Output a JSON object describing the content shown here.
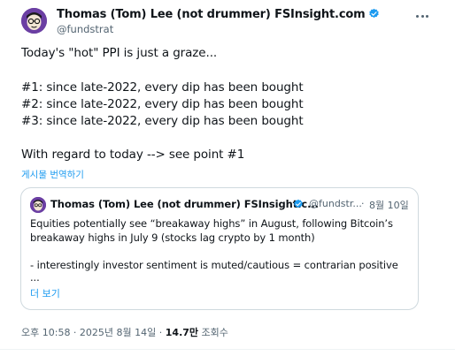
{
  "author": {
    "display_name": "Thomas (Tom) Lee (not drummer) FSInsight.com",
    "handle": "@fundstrat",
    "verified_color": "#1d9bf0",
    "avatar_icon": "cartoon-face-avatar"
  },
  "tweet": {
    "lines": [
      "Today's \"hot\" PPI is just a graze...",
      "#1: since late-2022, every dip has been bought",
      "#2: since late-2022, every dip has been bought",
      "#3: since late-2022, every dip has been bought",
      "With regard to today --> see point #1"
    ],
    "translate_label": "게시물 번역하기"
  },
  "quote": {
    "display_name": "Thomas (Tom) Lee (not drummer) FSInsight.c...",
    "handle": "@fundstr...",
    "separator": "·",
    "date": "8월 10일",
    "lines": [
      "Equities potentially see “breakaway highs” in August, following Bitcoin’s",
      "breakaway highs in July 9 (stocks lag crypto by 1 month)",
      "- interestingly investor sentiment is muted/cautious = contrarian positive",
      "..."
    ],
    "show_more_label": "더 보기"
  },
  "meta": {
    "time_date": "오후 10:58 · 2025년 8월 14일 · ",
    "views_count": "14.7만",
    "views_label": " 조회수"
  },
  "colors": {
    "accent": "#1d9bf0",
    "text": "#0f1419",
    "secondary": "#536471",
    "border": "#cfd9de"
  }
}
